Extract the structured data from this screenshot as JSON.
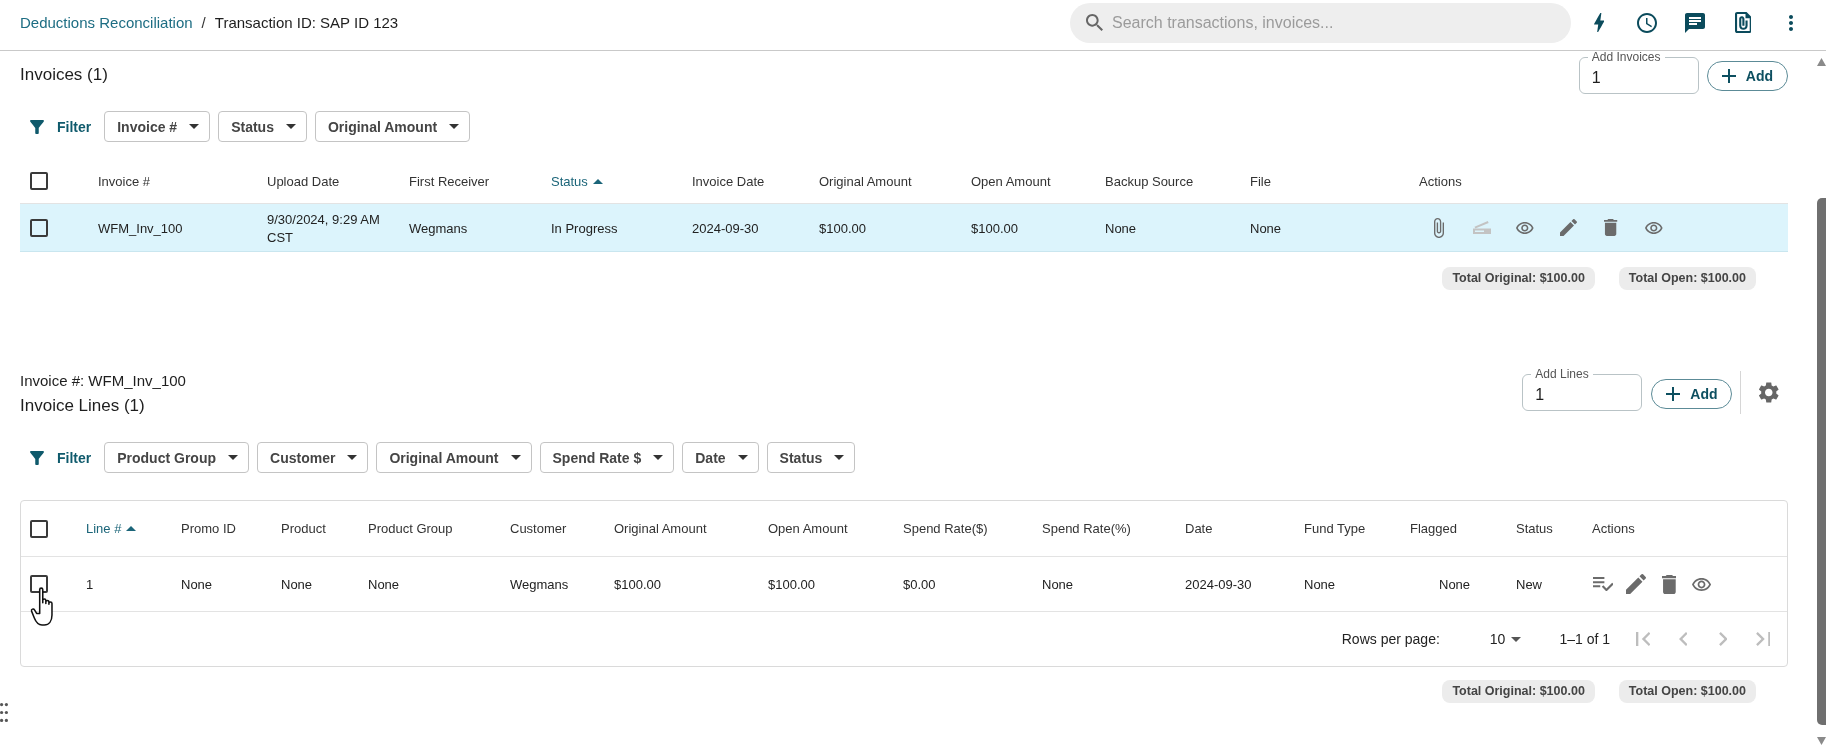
{
  "breadcrumb": [
    {
      "kind": "link",
      "label": "Deductions Reconciliation"
    },
    {
      "kind": "separator",
      "label": "/"
    },
    {
      "kind": "current",
      "label": "Transaction ID: SAP ID 123"
    }
  ],
  "search": {
    "placeholder": "Search transactions, invoices..."
  },
  "toolbar": [
    {
      "kind": "bolt"
    },
    {
      "kind": "history"
    },
    {
      "kind": "chat"
    },
    {
      "kind": "file"
    },
    {
      "kind": "more"
    }
  ],
  "invoices": {
    "title": "Invoices (1)",
    "add_field": {
      "label": "Add Invoices",
      "value": "1"
    },
    "add_button": "Add",
    "filter": {
      "label": "Filter",
      "chips": [
        "Invoice #",
        "Status",
        "Original Amount"
      ]
    },
    "table": {
      "select_all": {
        "checked": false
      },
      "columns": [
        {
          "label": "Invoice #",
          "sorted": false
        },
        {
          "label": "Upload Date",
          "sorted": false
        },
        {
          "label": "First Receiver",
          "sorted": false
        },
        {
          "label": "Status",
          "sorted": true
        },
        {
          "label": "Invoice Date",
          "sorted": false
        },
        {
          "label": "Original Amount",
          "sorted": false
        },
        {
          "label": "Open Amount",
          "sorted": false
        },
        {
          "label": "Backup Source",
          "sorted": false
        },
        {
          "label": "File",
          "sorted": false
        },
        {
          "label": "Actions",
          "sorted": false
        }
      ],
      "rows": [
        {
          "checked": false,
          "highlighted": true,
          "cells": [
            "WFM_Inv_100",
            "9/30/2024, 9:29 AM CST",
            "Wegmans",
            "In Progress",
            "2024-09-30",
            "$100.00",
            "$100.00",
            "None",
            "None"
          ],
          "actions": [
            {
              "kind": "attach",
              "disabled": false
            },
            {
              "kind": "scan",
              "disabled": true
            },
            {
              "kind": "view",
              "disabled": false
            },
            {
              "kind": "edit",
              "disabled": false
            },
            {
              "kind": "delete",
              "disabled": false
            },
            {
              "kind": "view",
              "disabled": false
            }
          ]
        }
      ]
    },
    "totals": [
      "Total Original: $100.00",
      "Total Open: $100.00"
    ]
  },
  "invoice_lines": {
    "invoice_label": "Invoice #: WFM_Inv_100",
    "title": "Invoice Lines (1)",
    "add_field": {
      "label": "Add Lines",
      "value": "1"
    },
    "add_button": "Add",
    "filter": {
      "label": "Filter",
      "chips": [
        "Product Group",
        "Customer",
        "Original Amount",
        "Spend Rate $",
        "Date",
        "Status"
      ]
    },
    "table": {
      "select_all": {
        "checked": false
      },
      "columns": [
        {
          "label": "Line #",
          "sorted": true
        },
        {
          "label": "Promo ID",
          "sorted": false
        },
        {
          "label": "Product",
          "sorted": false
        },
        {
          "label": "Product Group",
          "sorted": false
        },
        {
          "label": "Customer",
          "sorted": false
        },
        {
          "label": "Original Amount",
          "sorted": false
        },
        {
          "label": "Open Amount",
          "sorted": false
        },
        {
          "label": "Spend Rate($)",
          "sorted": false
        },
        {
          "label": "Spend Rate(%)",
          "sorted": false
        },
        {
          "label": "Date",
          "sorted": false
        },
        {
          "label": "Fund Type",
          "sorted": false
        },
        {
          "label": "Flagged",
          "sorted": false
        },
        {
          "label": "Status",
          "sorted": false
        },
        {
          "label": "Actions",
          "sorted": false
        }
      ],
      "rows": [
        {
          "checked": false,
          "cells": [
            "1",
            "None",
            "None",
            "None",
            "Wegmans",
            "$100.00",
            "$100.00",
            "$0.00",
            "None",
            "2024-09-30",
            "None",
            "None",
            "New"
          ],
          "actions": [
            {
              "kind": "checklist"
            },
            {
              "kind": "edit"
            },
            {
              "kind": "delete"
            },
            {
              "kind": "view"
            }
          ]
        }
      ]
    },
    "pagination": {
      "rows_per_page_label": "Rows per page:",
      "rows_per_page": "10",
      "range": "1–1 of 1",
      "buttons": [
        {
          "kind": "first",
          "disabled": true
        },
        {
          "kind": "previous",
          "disabled": true
        },
        {
          "kind": "next",
          "disabled": true
        },
        {
          "kind": "last",
          "disabled": true
        }
      ]
    },
    "totals": [
      "Total Original: $100.00",
      "Total Open: $100.00"
    ]
  }
}
